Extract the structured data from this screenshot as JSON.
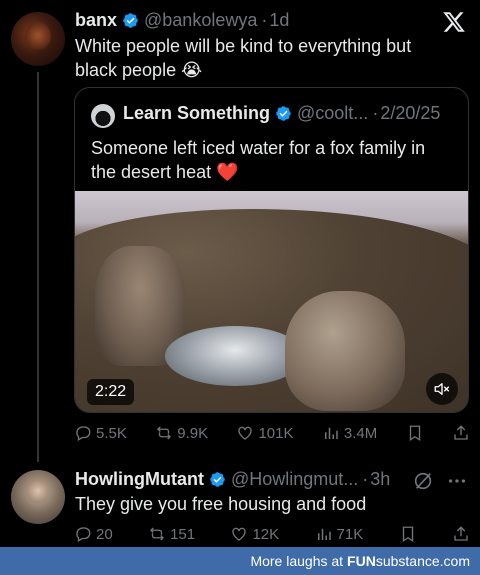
{
  "tweet": {
    "name": "banx",
    "handle": "@bankolewya",
    "time": "1d",
    "text": "White people will be kind to everything but black people 😭"
  },
  "quote": {
    "name": "Learn Something",
    "handle": "@coolt...",
    "date": "2/20/25",
    "text": "Someone left iced water for a fox family in the desert heat ❤️",
    "video_duration": "2:22"
  },
  "tweet_stats": {
    "replies": "5.5K",
    "retweets": "9.9K",
    "likes": "101K",
    "views": "3.4M"
  },
  "reply": {
    "name": "HowlingMutant",
    "handle": "@Howlingmut...",
    "time": "3h",
    "text": "They give you free housing and food",
    "stats": {
      "replies": "20",
      "retweets": "151",
      "likes": "12K",
      "views": "71K"
    }
  },
  "footer": {
    "prefix": "More laughs at",
    "brand_bold": "FUN",
    "brand_rest": "substance",
    "suffix": ".com"
  },
  "colors": {
    "verified": "#1d9bf0",
    "muted": "#71767b",
    "heart": "#f91880",
    "footer_bg": "#3f6ba8"
  },
  "icons": [
    "x-logo-icon",
    "verified-icon",
    "reply-icon",
    "retweet-icon",
    "like-icon",
    "views-icon",
    "bookmark-icon",
    "share-icon",
    "mute-icon",
    "grok-icon",
    "more-icon"
  ]
}
